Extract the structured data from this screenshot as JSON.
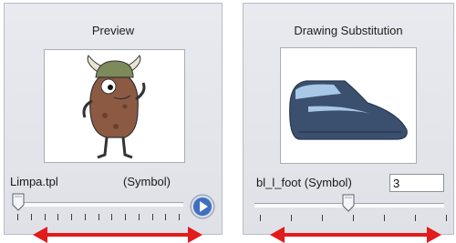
{
  "preview_panel": {
    "title": "Preview",
    "template_name": "Limpa.tpl",
    "template_type": "(Symbol)",
    "play_icon": "play-icon"
  },
  "substitution_panel": {
    "title": "Drawing Substitution",
    "drawing_label": "bl_l_foot (Symbol)",
    "frame_value": "3"
  },
  "colors": {
    "arrow": "#e21b1b",
    "play_button": "#3f6fbf",
    "shoe_dark": "#3b4f6e",
    "shoe_light": "#a9c8e8",
    "creature_body": "#8c5a43",
    "creature_helmet": "#7d8a5a"
  }
}
